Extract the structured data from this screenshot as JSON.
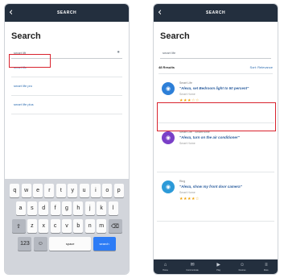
{
  "left": {
    "topbar_title": "SEARCH",
    "back_glyph": "‹",
    "heading": "Search",
    "search_value": "smart lift",
    "suggestions": [
      "smart life",
      "smart life pro",
      "smart life plus"
    ],
    "keyboard": {
      "row1": [
        "q",
        "w",
        "e",
        "r",
        "t",
        "y",
        "u",
        "i",
        "o",
        "p"
      ],
      "row2": [
        "a",
        "s",
        "d",
        "f",
        "g",
        "h",
        "j",
        "k",
        "l"
      ],
      "row3": [
        "z",
        "x",
        "c",
        "v",
        "b",
        "n",
        "m"
      ],
      "space_label": "space",
      "go_label": "search"
    }
  },
  "right": {
    "topbar_title": "SEARCH",
    "back_glyph": "‹",
    "heading": "Search",
    "search_value": "smart life",
    "results_count": "48 Results",
    "sort_label": "Sort: Relevance",
    "results": [
      {
        "name": "Smart Life",
        "phrase": "\"Alexa, set Bedroom light to 50 percent\"",
        "sub": "Smart Home",
        "stars": "★★★☆☆",
        "color": "#2d7fd8",
        "icon": "◉"
      },
      {
        "name": "Smart Life · SmartHome",
        "phrase": "\"Alexa, turn on the air conditioner\"",
        "sub": "Smart Home",
        "stars": "",
        "color": "#7a3fc7",
        "icon": "◉"
      },
      {
        "name": "Ring",
        "phrase": "\"Alexa, show my front door camera\"",
        "sub": "Smart Home",
        "stars": "★★★★☆",
        "color": "#2d9ad8",
        "icon": "◉"
      }
    ],
    "nav": [
      {
        "icon": "⌂",
        "label": "Home"
      },
      {
        "icon": "✉",
        "label": "Communicate"
      },
      {
        "icon": "▶",
        "label": "Play"
      },
      {
        "icon": "☺",
        "label": "Devices"
      },
      {
        "icon": "≡",
        "label": "More"
      }
    ]
  },
  "colors": {
    "topbar": "#232f3e",
    "highlight": "#d9232e",
    "link": "#2c6cb0",
    "go_key": "#2d7cf6"
  }
}
